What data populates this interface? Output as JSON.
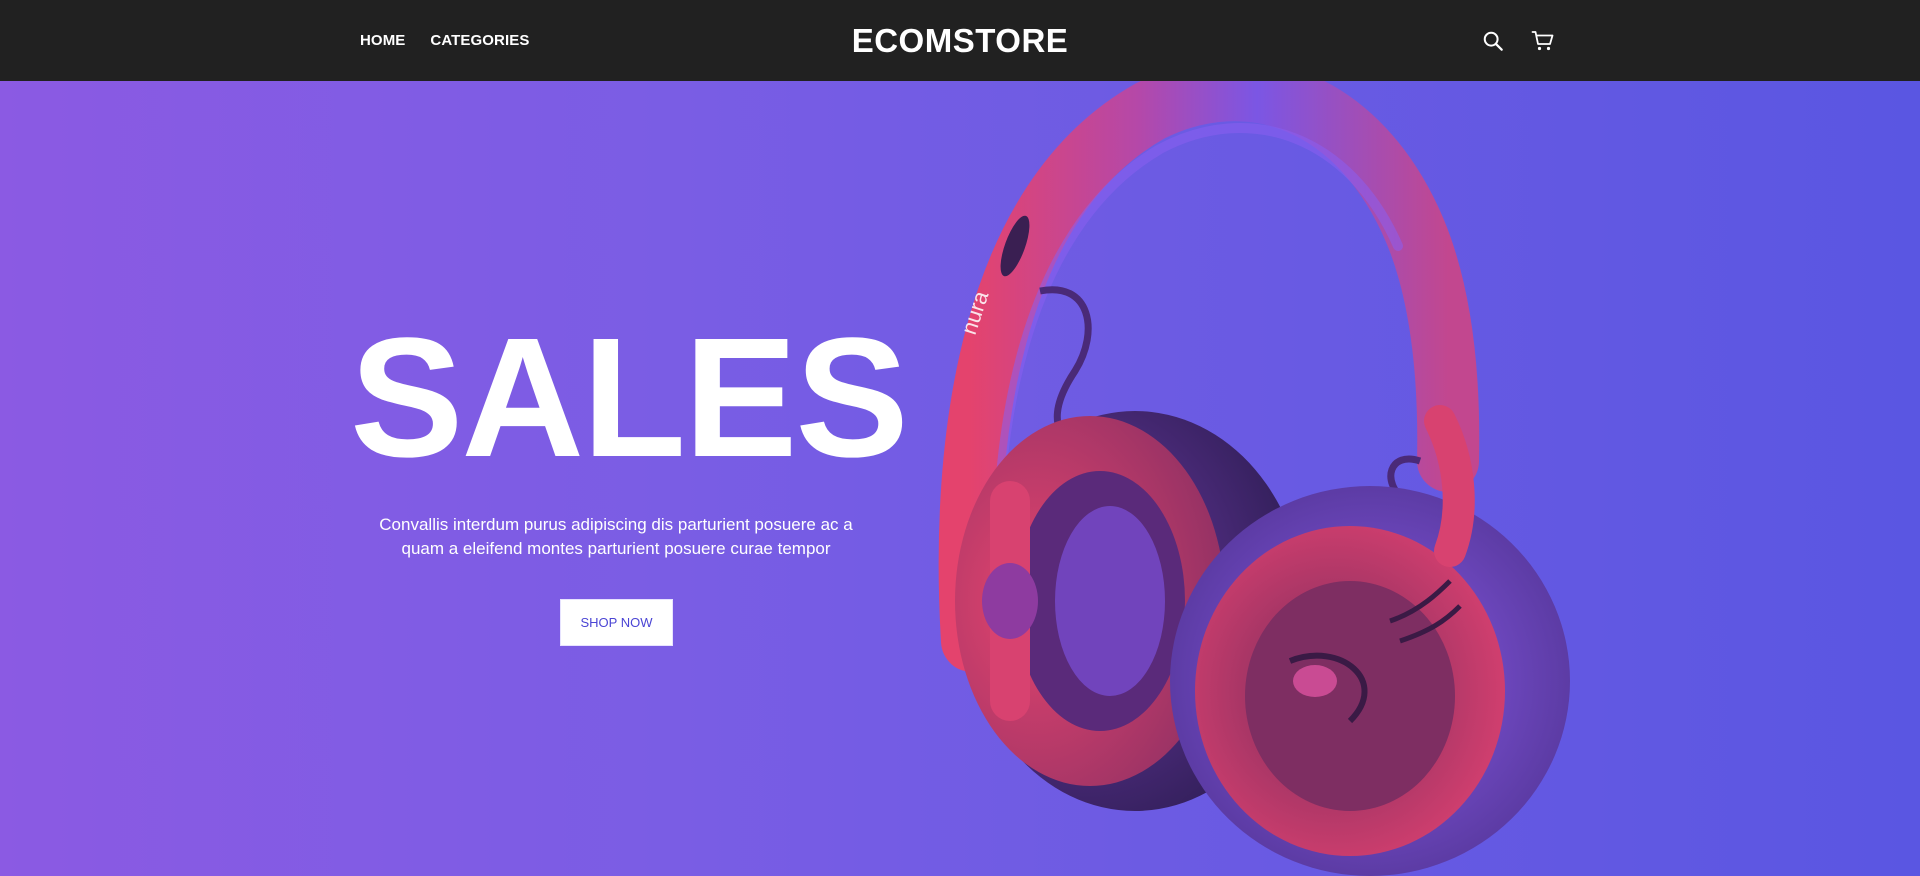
{
  "nav": {
    "home": "HOME",
    "categories": "CATEGORIES"
  },
  "brand": {
    "name": "ECOMSTORE"
  },
  "icons": {
    "search": "search-icon",
    "cart": "cart-icon"
  },
  "hero": {
    "title": "SALES",
    "subtitle_line1": "Convallis interdum purus adipiscing dis parturient posuere ac a",
    "subtitle_line2": "quam a eleifend montes parturient posuere curae tempor",
    "cta": "SHOP NOW",
    "product_brand": "nura"
  },
  "colors": {
    "header_bg": "#212121",
    "hero_left": "#8b5ae3",
    "hero_right": "#5a56e2",
    "accent": "#4b45d4",
    "headphone_pink": "#e0426f",
    "headphone_violet": "#7b55e6"
  }
}
